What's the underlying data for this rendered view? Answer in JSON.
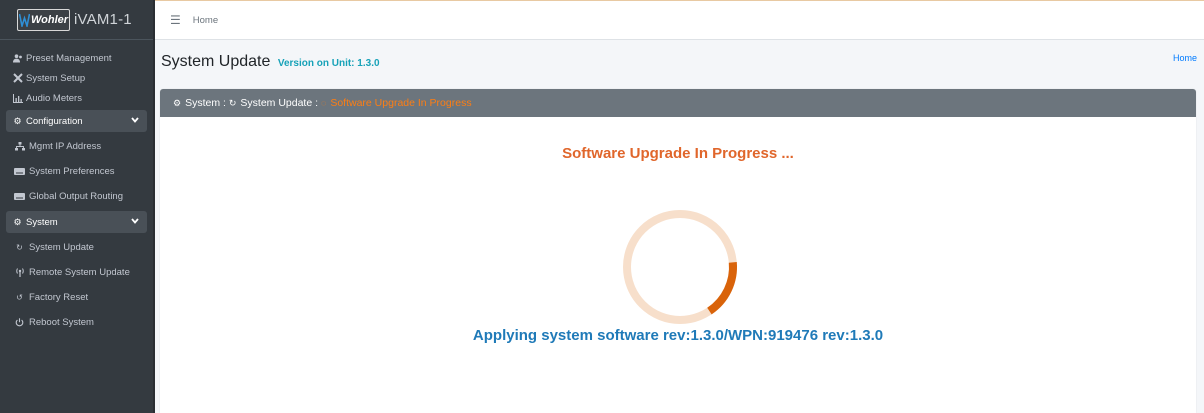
{
  "brand": {
    "logo_text": "Wohler",
    "product": "iVAM1-1"
  },
  "topbar": {
    "menu_icon": "hamburger-icon",
    "home_label": "Home"
  },
  "sidebar": {
    "items": [
      {
        "label": "Preset Management",
        "icon": "users-icon"
      },
      {
        "label": "System Setup",
        "icon": "tools-icon"
      },
      {
        "label": "Audio Meters",
        "icon": "chart-icon"
      }
    ],
    "configuration": {
      "label": "Configuration",
      "icon": "gear-icon",
      "items": [
        {
          "label": "Mgmt IP Address",
          "icon": "network-icon"
        },
        {
          "label": "System Preferences",
          "icon": "keyboard-icon"
        },
        {
          "label": "Global Output Routing",
          "icon": "keyboard-icon"
        }
      ]
    },
    "system": {
      "label": "System",
      "icon": "gears-icon",
      "items": [
        {
          "label": "System Update",
          "icon": "sync-icon"
        },
        {
          "label": "Remote System Update",
          "icon": "antenna-icon"
        },
        {
          "label": "Factory Reset",
          "icon": "undo-icon"
        },
        {
          "label": "Reboot System",
          "icon": "power-icon"
        }
      ]
    }
  },
  "header": {
    "title": "System Update",
    "version_label": "Version on Unit: 1.3.0",
    "breadcrumb": "Home"
  },
  "card": {
    "crumb_system": "System",
    "crumb_update": "System Update",
    "crumb_progress": "Software Upgrade In Progress",
    "progress_title": "Software Upgrade In Progress ...",
    "applying_text": "Applying system software rev:1.3.0/WPN:919476 rev:1.3.0",
    "spinner_progress": 0.17
  },
  "colors": {
    "accent_orange": "#e0662b",
    "spinner_track": "#f7dfcb",
    "spinner_fill": "#d9630a",
    "applying_blue": "#1f7ab8"
  }
}
